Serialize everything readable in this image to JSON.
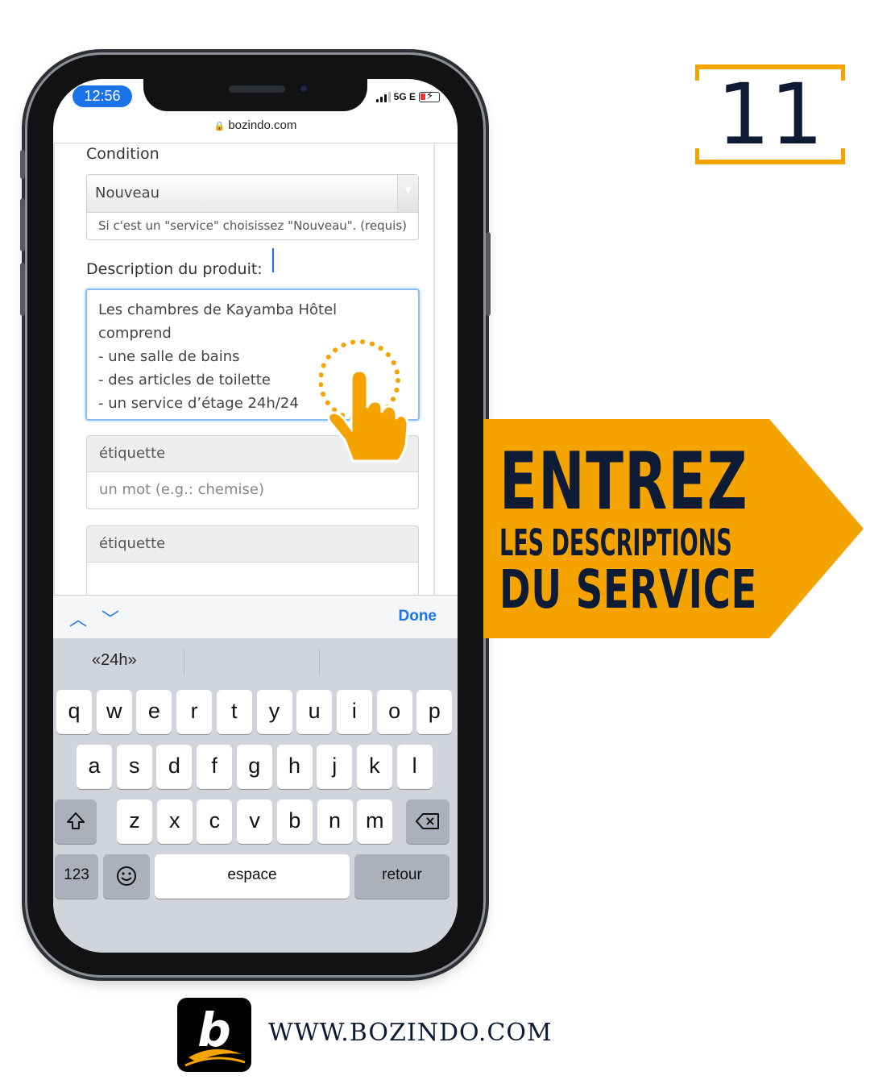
{
  "status_bar": {
    "time": "12:56",
    "network": "5G E"
  },
  "browser": {
    "url": "bozindo.com"
  },
  "form": {
    "condition_label": "Condition",
    "condition_value": "Nouveau",
    "condition_help": "Si c'est un \"service\" choisissez \"Nouveau\". (requis)",
    "description_label": "Description du produit:",
    "description_value": "Les chambres de Kayamba Hôtel\ncomprend\n- une salle de bains\n- des articles de toilette\n- un service d’étage 24h/24",
    "tag_label_1": "étiquette",
    "tag_placeholder_1": "un mot (e.g.: chemise)",
    "tag_label_2": "étiquette"
  },
  "keyboard": {
    "done_label": "Done",
    "suggestion": "«24h»",
    "row1": [
      "q",
      "w",
      "e",
      "r",
      "t",
      "y",
      "u",
      "i",
      "o",
      "p"
    ],
    "row2": [
      "a",
      "s",
      "d",
      "f",
      "g",
      "h",
      "j",
      "k",
      "l"
    ],
    "row3": [
      "z",
      "x",
      "c",
      "v",
      "b",
      "n",
      "m"
    ],
    "numbers_label": "123",
    "space_label": "espace",
    "return_label": "retour"
  },
  "step_number": "11",
  "banner": {
    "line1": "ENTREZ",
    "line2": "LES DESCRIPTIONS",
    "line3": "DU SERVICE"
  },
  "footer": {
    "logo_letter": "b",
    "website": "WWW.BOZINDO.COM"
  },
  "colors": {
    "accent": "#f5a300",
    "navy": "#0d1b34",
    "ios_blue": "#1a73e8"
  }
}
